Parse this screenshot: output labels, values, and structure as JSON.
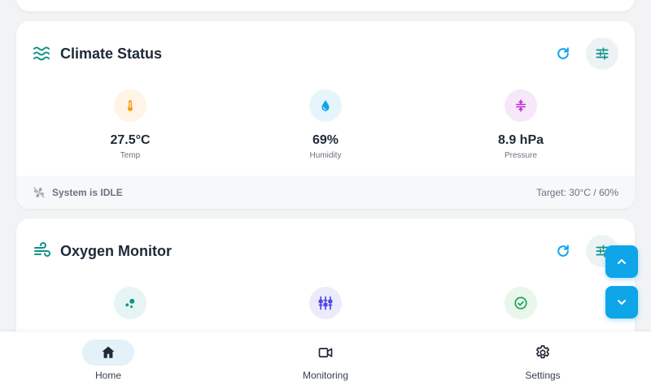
{
  "climate": {
    "title": "Climate Status",
    "metrics": [
      {
        "value": "27.5°C",
        "label": "Temp",
        "icon": "thermometer-icon",
        "color": "#f59e0b"
      },
      {
        "value": "69%",
        "label": "Humidity",
        "icon": "water-drop-icon",
        "color": "#0ea5e9"
      },
      {
        "value": "8.9 hPa",
        "label": "Pressure",
        "icon": "compress-icon",
        "color": "#c026d3"
      }
    ],
    "status_text": "System is IDLE",
    "target_text": "Target: 30°C / 60%"
  },
  "oxygen": {
    "title": "Oxygen Monitor",
    "metrics": [
      {
        "icon": "bubbles-icon",
        "color": "#0d9488"
      },
      {
        "icon": "sensor-array-icon",
        "color": "#4f46e5"
      },
      {
        "icon": "check-circle-icon",
        "color": "#16a34a"
      }
    ]
  },
  "nav": {
    "items": [
      {
        "label": "Home",
        "icon": "home-icon",
        "active": true
      },
      {
        "label": "Monitoring",
        "icon": "video-camera-icon",
        "active": false
      },
      {
        "label": "Settings",
        "icon": "gear-icon",
        "active": false
      }
    ]
  },
  "colors": {
    "accent": "#0ea5e9",
    "teal": "#0d9488",
    "text": "#1f2937",
    "muted": "#6b7280"
  }
}
